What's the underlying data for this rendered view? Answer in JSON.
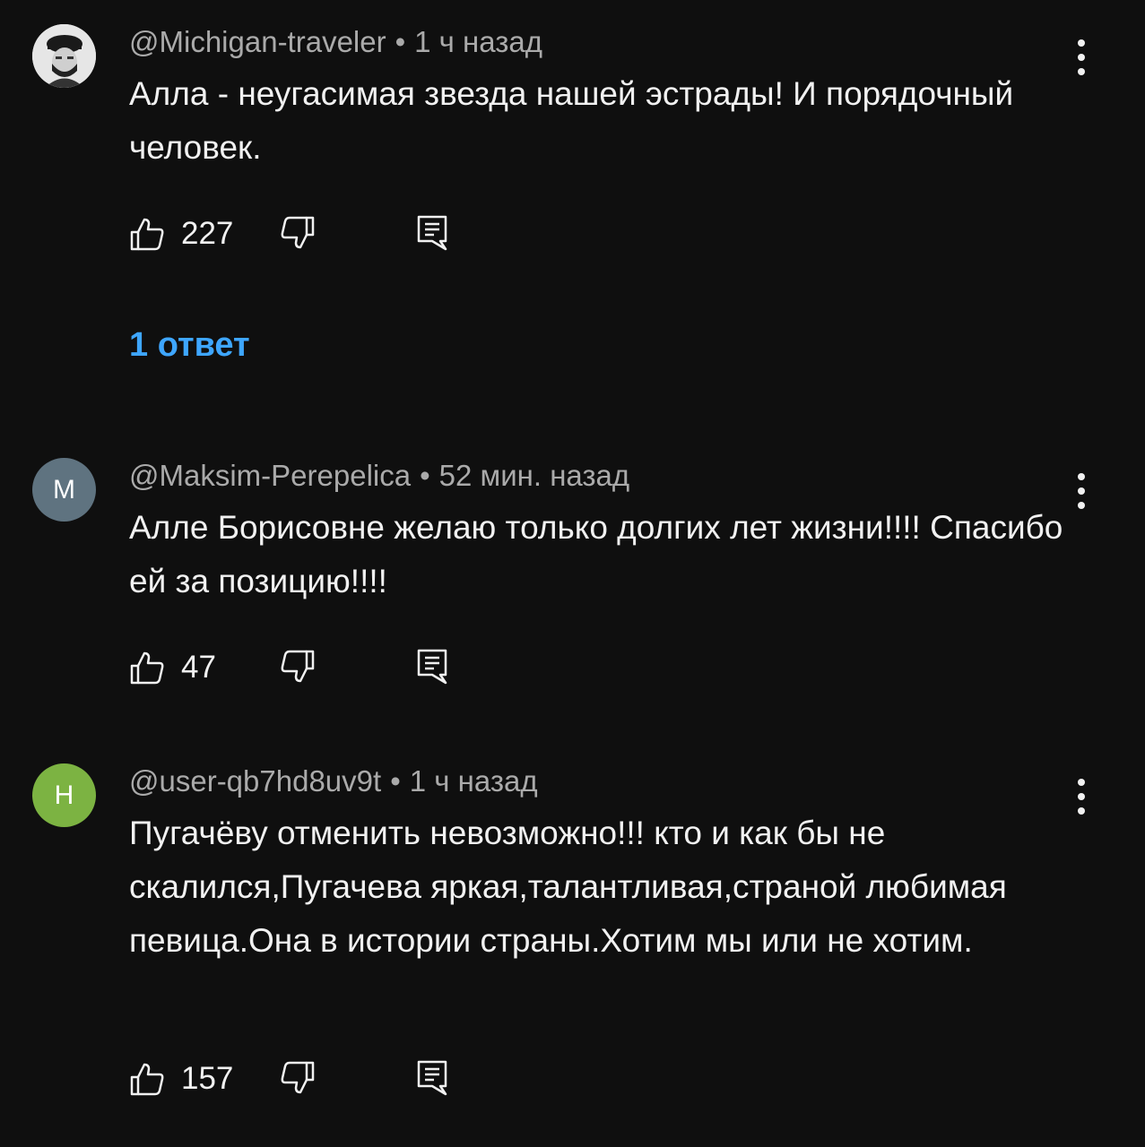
{
  "comments": [
    {
      "author": "@Michigan-traveler",
      "time": "1 ч назад",
      "text": "Алла - неугасимая звезда нашей эстрады! И порядочный человек.",
      "likes": "227",
      "avatar_letter": "",
      "avatar_color": "#e8e8e8",
      "avatar_icon": "profile-photo"
    },
    {
      "author": "@Maksim-Perepelica",
      "time": "52 мин. назад",
      "text": "Алле Борисовне желаю только долгих лет жизни!!!! Спасибо ей за позицию!!!!",
      "likes": "47",
      "avatar_letter": "М",
      "avatar_color": "#5f7380"
    },
    {
      "author": "@user-qb7hd8uv9t",
      "time": "1 ч назад",
      "text": "Пугачёву отменить невозможно!!! кто и как бы не скалился,Пугачева яркая,талантливая,страной любимая певица.Она в истории страны.Хотим мы или не хотим.",
      "likes": "157",
      "avatar_letter": "Н",
      "avatar_color": "#7cb342"
    }
  ],
  "replies_link": "1 ответ",
  "meta_separator": "•",
  "colors": {
    "background": "#0f0f0f",
    "text": "#f1f1f1",
    "meta": "#aaaaaa",
    "link": "#3ea6ff"
  }
}
